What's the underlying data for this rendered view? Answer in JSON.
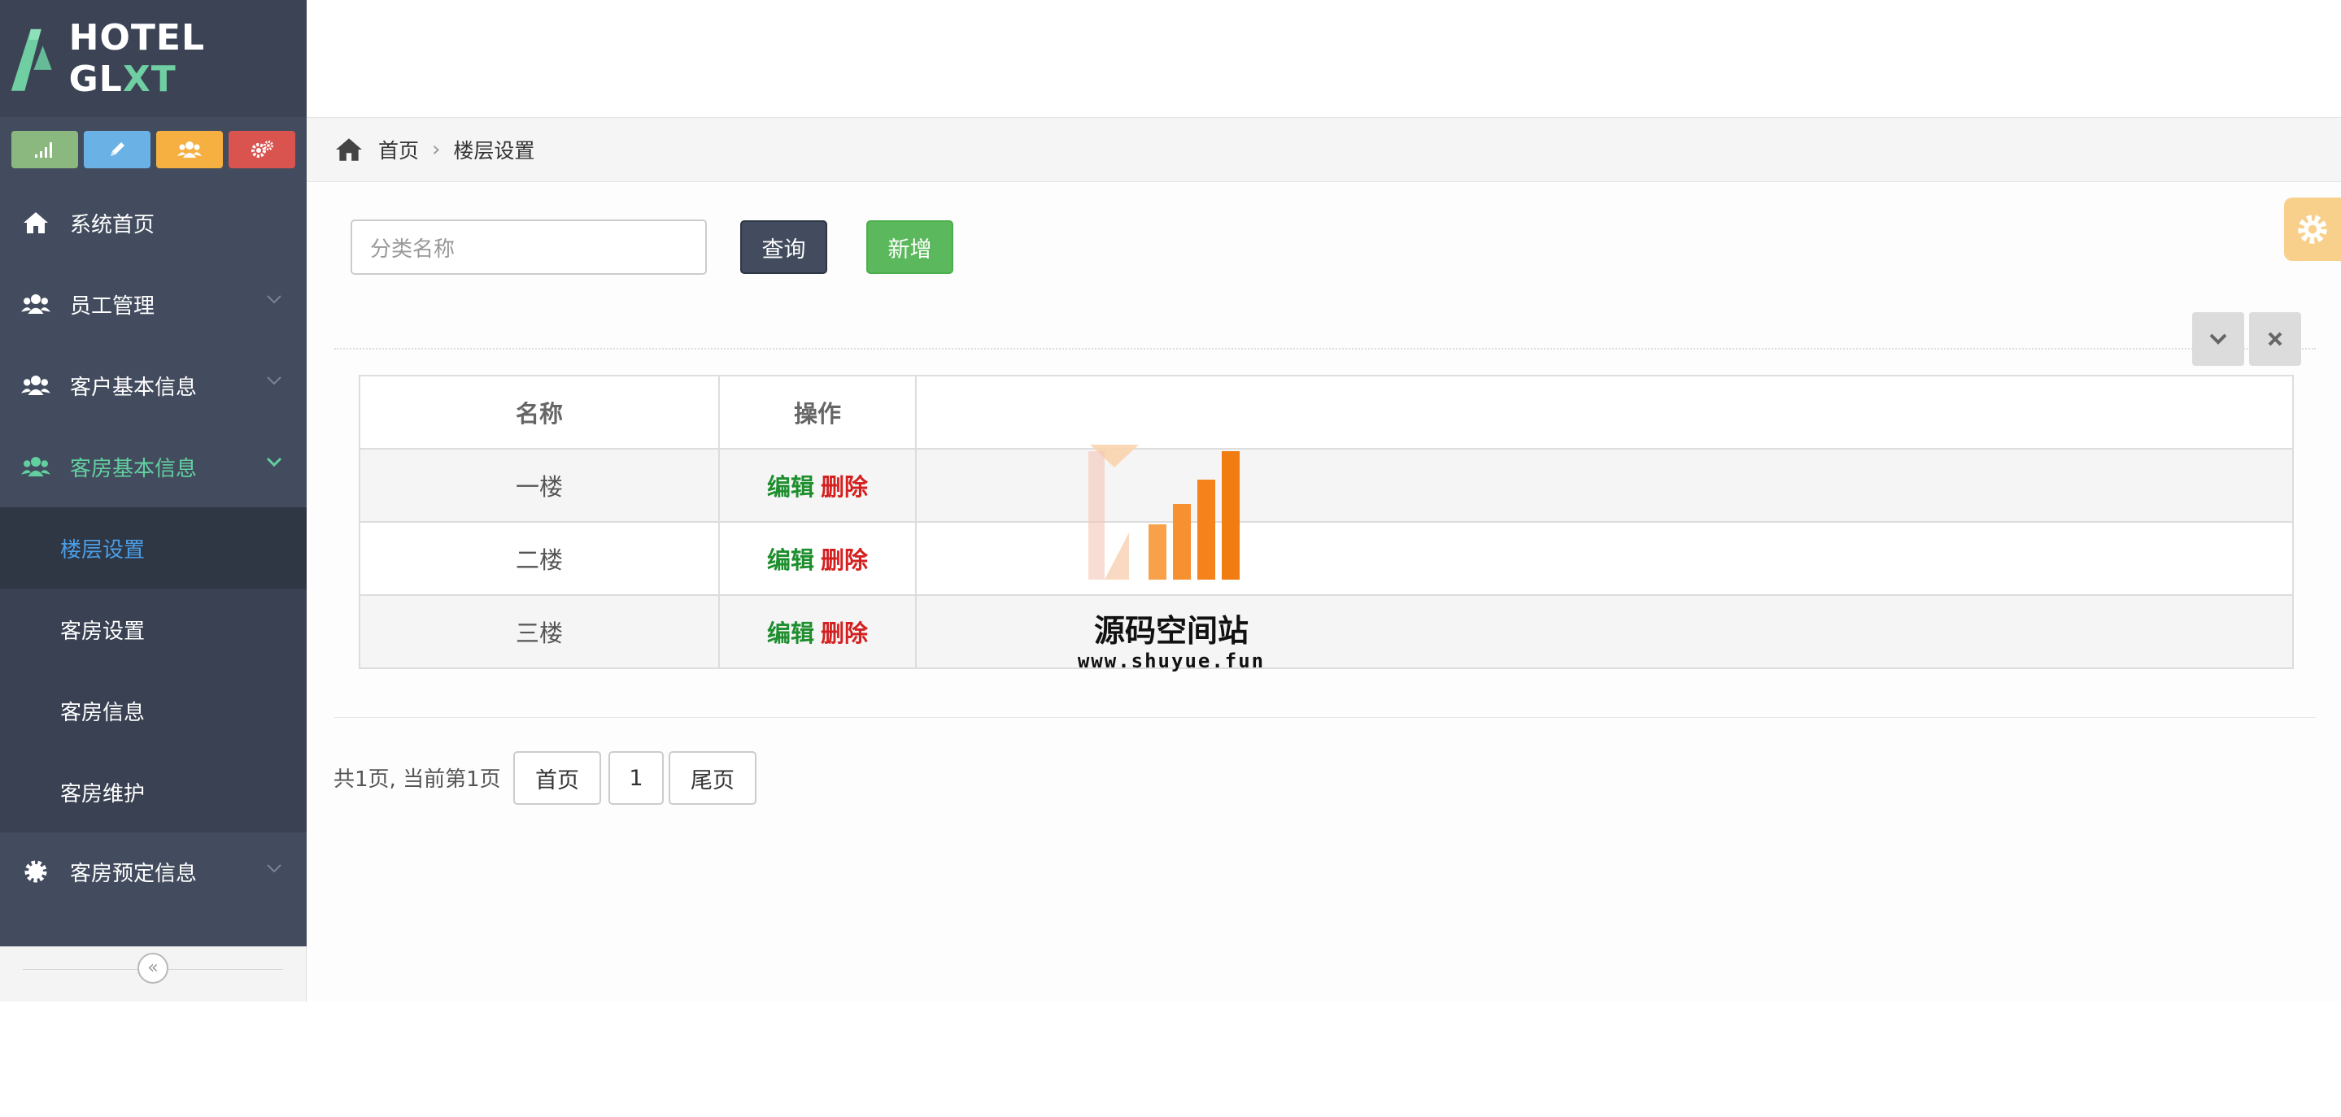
{
  "app": {
    "logo_text": "HOTEL GL",
    "logo_text_accent": "XT",
    "accent_color": "#62cfa0"
  },
  "shortcuts": [
    {
      "icon": "signal-icon",
      "color": "#8ab87e"
    },
    {
      "icon": "pencil-icon",
      "color": "#6ab2e6"
    },
    {
      "icon": "group-icon",
      "color": "#f5b041"
    },
    {
      "icon": "gears-icon",
      "color": "#d9534f"
    }
  ],
  "sidebar": {
    "items": [
      {
        "label": "系统首页",
        "icon": "home-icon"
      },
      {
        "label": "员工管理",
        "icon": "group-icon"
      },
      {
        "label": "客户基本信息",
        "icon": "group-icon"
      },
      {
        "label": "客房基本信息",
        "icon": "group-icon",
        "expanded": true
      },
      {
        "label": "客房预定信息",
        "icon": "gear-icon"
      }
    ],
    "submenu": [
      {
        "label": "楼层设置",
        "current": true
      },
      {
        "label": "客房设置"
      },
      {
        "label": "客房信息"
      },
      {
        "label": "客房维护"
      }
    ],
    "collapse_glyph": "«"
  },
  "breadcrumb": {
    "home": "首页",
    "separator": "›",
    "current": "楼层设置"
  },
  "search": {
    "placeholder": "分类名称",
    "query_label": "查询",
    "add_label": "新增"
  },
  "table": {
    "headers": [
      "名称",
      "操作",
      ""
    ],
    "rows": [
      {
        "name": "一楼",
        "edit": "编辑",
        "delete": "删除"
      },
      {
        "name": "二楼",
        "edit": "编辑",
        "delete": "删除"
      },
      {
        "name": "三楼",
        "edit": "编辑",
        "delete": "删除"
      }
    ]
  },
  "pagination": {
    "info": "共1页, 当前第1页",
    "first": "首页",
    "page": "1",
    "last": "尾页"
  },
  "watermark": {
    "title": "源码空间站",
    "url": "www.shuyue.fun"
  }
}
